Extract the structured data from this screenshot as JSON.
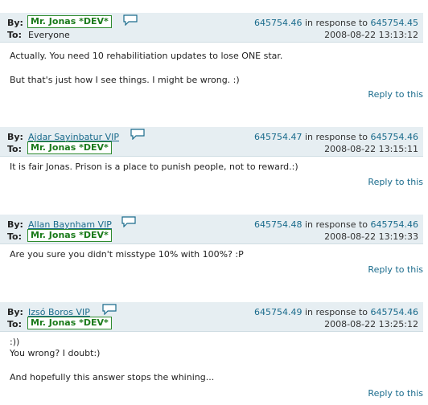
{
  "labels": {
    "by": "By:",
    "to": "To:",
    "in_response_to": "in response to",
    "reply": "Reply to this"
  },
  "posts": [
    {
      "author": "Mr. Jonas *DEV*",
      "recipient": "Everyone",
      "id": "645754.46",
      "parent_id": "645754.45",
      "date": "2008-08-22 13:13:12",
      "lines": [
        "Actually. You need 10 rehabilitiation updates to lose ONE star.",
        "But that's just how I see things. I might be wrong. :)"
      ]
    },
    {
      "author": "Ajdar Sayinbatur VIP",
      "recipient": "Mr. Jonas *DEV*",
      "id": "645754.47",
      "parent_id": "645754.46",
      "date": "2008-08-22 13:15:11",
      "lines": [
        "It is fair Jonas. Prison is a place to punish people, not to reward.:)"
      ]
    },
    {
      "author": "Allan Baynham VIP",
      "recipient": "Mr. Jonas *DEV*",
      "id": "645754.48",
      "parent_id": "645754.46",
      "date": "2008-08-22 13:19:33",
      "lines": [
        "Are you sure you didn't misstype 10% with 100%? :P"
      ]
    },
    {
      "author": "Izsó Boros VIP",
      "recipient": "Mr. Jonas *DEV*",
      "id": "645754.49",
      "parent_id": "645754.46",
      "date": "2008-08-22 13:25:12",
      "lines": [
        ":))",
        "You wrong? I doubt:)",
        "And hopefully this answer stops the whining..."
      ]
    }
  ],
  "colors": {
    "link": "#1a6b8c",
    "header_bg": "#e6eef2",
    "dev_border": "#2e8b2e",
    "dev_text": "#1a7a1a"
  }
}
